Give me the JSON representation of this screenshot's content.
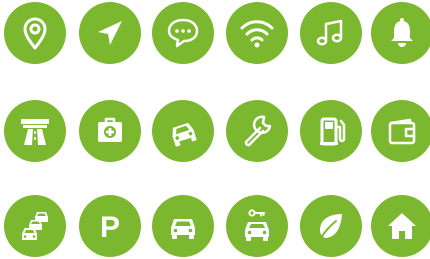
{
  "palette": {
    "icon_green": "#7cb82f",
    "glyph": "#ffffff",
    "background": "#ffffff"
  },
  "parking": {
    "letter": "P"
  },
  "icons": [
    [
      "map-pin-icon",
      "paper-plane-icon",
      "chat-bubbles-icon",
      "wifi-icon",
      "music-note-icon",
      "bell-icon"
    ],
    [
      "highway-icon",
      "first-aid-kit-icon",
      "car-crash-icon",
      "wrench-icon",
      "fuel-pump-icon",
      "wallet-icon"
    ],
    [
      "traffic-jam-icon",
      "parking-icon",
      "car-front-icon",
      "car-rental-key-icon",
      "leaf-icon",
      "home-icon"
    ]
  ]
}
